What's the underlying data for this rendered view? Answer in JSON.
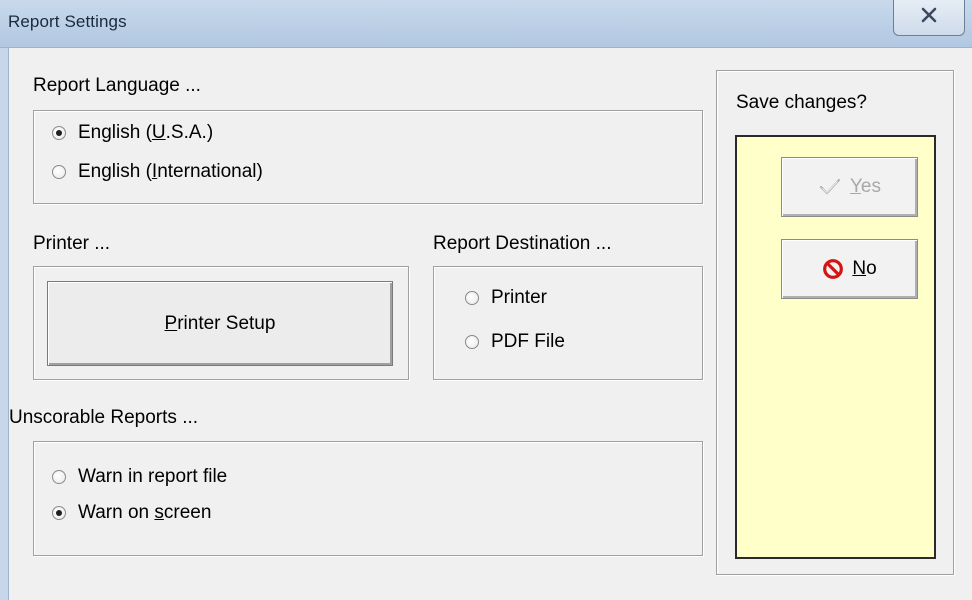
{
  "window": {
    "title": "Report Settings",
    "close_icon": "close-icon"
  },
  "language": {
    "label": "Report Language ...",
    "options": [
      {
        "before": "English (",
        "mnemonic": "U",
        "after": ".S.A.)",
        "checked": true
      },
      {
        "before": "English (",
        "mnemonic": "I",
        "after": "nternational)",
        "checked": false
      }
    ]
  },
  "printer": {
    "label": "Printer ...",
    "button": {
      "mnemonic": "P",
      "after": "rinter Setup"
    }
  },
  "destination": {
    "label": "Report Destination ...",
    "options": [
      {
        "text": "Printer",
        "checked": false
      },
      {
        "text": "PDF File",
        "checked": false
      }
    ]
  },
  "unscorable": {
    "label": "Unscorable Reports ...",
    "options": [
      {
        "before": "Warn in report file",
        "mnemonic": "",
        "after": "",
        "checked": false
      },
      {
        "before": "Warn on ",
        "mnemonic": "s",
        "after": "creen",
        "checked": true
      }
    ]
  },
  "save": {
    "label": "Save changes?",
    "panel_color": "#ffffc9",
    "yes": {
      "mnemonic": "Y",
      "after": "es",
      "icon": "checkmark-icon",
      "disabled": true
    },
    "no": {
      "mnemonic": "N",
      "after": "o",
      "icon": "no-entry-icon",
      "disabled": false
    }
  }
}
